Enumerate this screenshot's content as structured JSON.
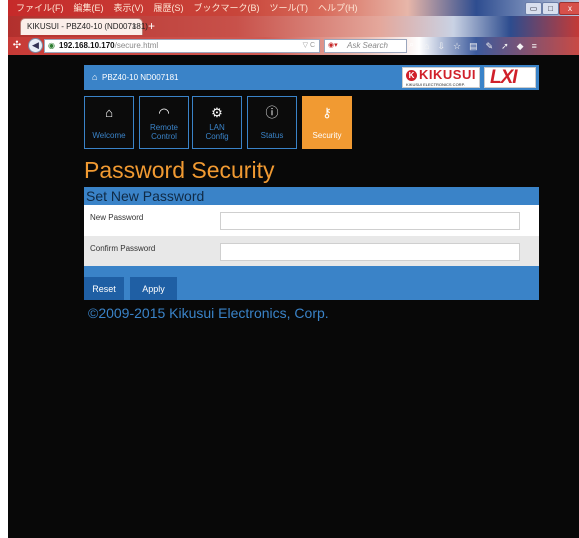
{
  "menu": [
    "ファイル(F)",
    "編集(E)",
    "表示(V)",
    "履歴(S)",
    "ブックマーク(B)",
    "ツール(T)",
    "ヘルプ(H)"
  ],
  "window_buttons": {
    "minimize": "▭",
    "maximize": "□",
    "close": "x"
  },
  "tab": {
    "title": "KIKUSUI - PBZ40-10 (ND007181)",
    "close": "×",
    "new_tab": "+"
  },
  "navbar": {
    "url_host": "192.168.10.170",
    "url_path": "/secure.html",
    "search_placeholder": "Ask Search"
  },
  "page": {
    "header_model": "PBZ40-10 ND007181",
    "logo_brand": "KIKUSUI",
    "logo_sub": "KIKUSUI ELECTRONICS CORP.",
    "logo_lxi": "LXI",
    "tiles": {
      "welcome": "Welcome",
      "remote_line1": "Remote",
      "remote_line2": "Control",
      "lan_line1": "LAN",
      "lan_line2": "Config",
      "status": "Status",
      "security": "Security"
    },
    "title": "Password Security",
    "form_heading": "Set New Password",
    "new_password_label": "New Password",
    "confirm_password_label": "Confirm Password",
    "reset_label": "Reset",
    "apply_label": "Apply",
    "copyright": "©2009-2015 Kikusui Electronics, Corp."
  },
  "colors": {
    "accent_blue": "#3a83c8",
    "accent_orange": "#f19a32",
    "page_bg": "#080808"
  }
}
